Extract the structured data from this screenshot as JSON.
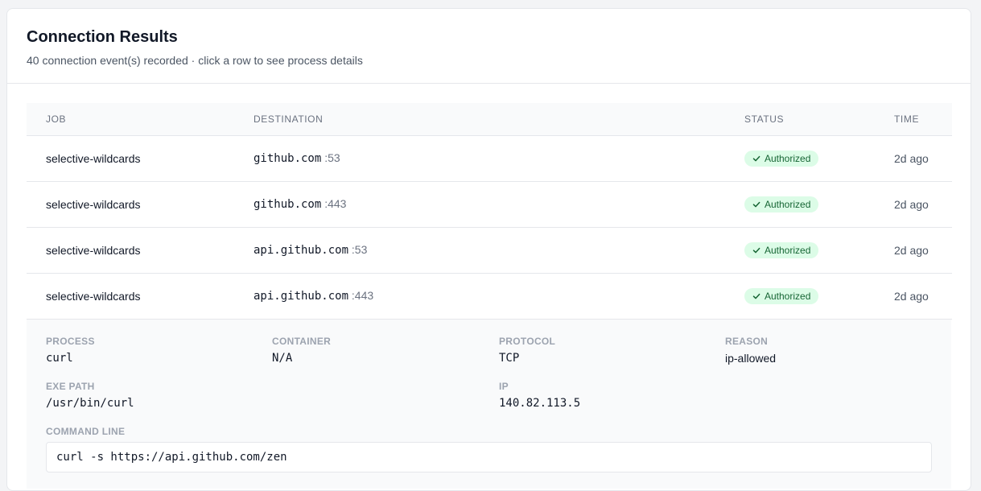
{
  "header": {
    "title": "Connection Results",
    "subtitle": "40 connection event(s) recorded · click a row to see process details"
  },
  "table": {
    "columns": [
      "JOB",
      "DESTINATION",
      "STATUS",
      "TIME"
    ],
    "rows": [
      {
        "job": "selective-wildcards",
        "host": "github.com",
        "port": ":53",
        "status": "Authorized",
        "time": "2d ago"
      },
      {
        "job": "selective-wildcards",
        "host": "github.com",
        "port": ":443",
        "status": "Authorized",
        "time": "2d ago"
      },
      {
        "job": "selective-wildcards",
        "host": "api.github.com",
        "port": ":53",
        "status": "Authorized",
        "time": "2d ago"
      },
      {
        "job": "selective-wildcards",
        "host": "api.github.com",
        "port": ":443",
        "status": "Authorized",
        "time": "2d ago"
      }
    ]
  },
  "details": {
    "process_label": "PROCESS",
    "process": "curl",
    "container_label": "CONTAINER",
    "container": "N/A",
    "protocol_label": "PROTOCOL",
    "protocol": "TCP",
    "reason_label": "REASON",
    "reason": "ip-allowed",
    "exe_label": "EXE PATH",
    "exe": "/usr/bin/curl",
    "ip_label": "IP",
    "ip": "140.82.113.5",
    "cmd_label": "COMMAND LINE",
    "cmd": "curl -s https://api.github.com/zen"
  },
  "colors": {
    "badge_bg": "#dcfce7",
    "badge_text": "#166534",
    "header_bg": "#f9fafb"
  }
}
